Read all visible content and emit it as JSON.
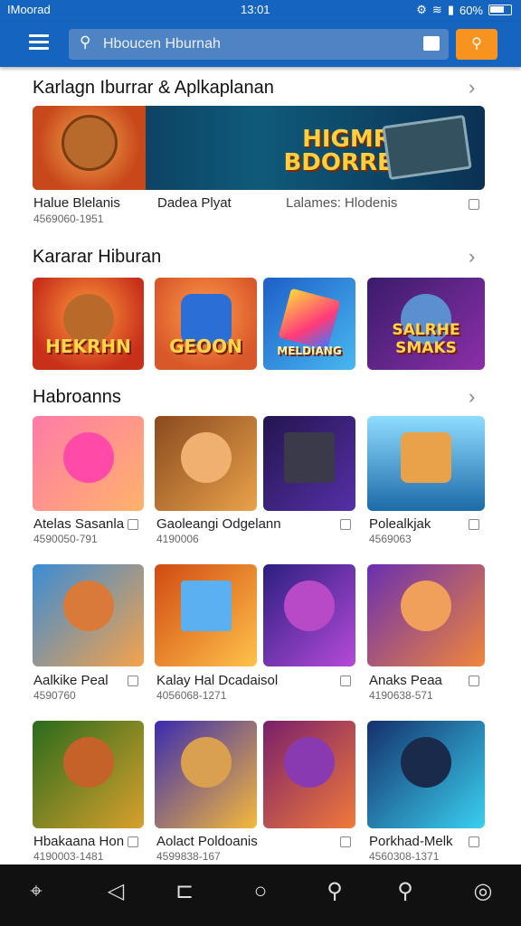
{
  "status": {
    "carrier": "IMoorad",
    "time": "13:01",
    "battery": "60%"
  },
  "topbar": {
    "search_text": "Hboucen Hburnah"
  },
  "sections": {
    "featured": {
      "title": "Karlagn Iburrar & Aplkaplanan"
    },
    "popular": {
      "title": "Kararar Hiburan"
    },
    "more": {
      "title": "Habroanns"
    }
  },
  "banner": {
    "title": "HIGMRA BDORRERS",
    "captions": [
      "Halue Blelanis",
      "Dadea Plyat",
      "Lalames: Hlodenis"
    ],
    "sub": "4569060-1951"
  },
  "popular_tiles": [
    {
      "label": "HEKRHN"
    },
    {
      "label": "GEOON"
    },
    {
      "label": "MELDIANG"
    },
    {
      "label": "SALRHE SMAKS"
    }
  ],
  "grid_rows": [
    [
      {
        "name": "Atelas Sasanla",
        "sub": "4590050-791",
        "colors": [
          "#ff7aa8",
          "#ffb36b"
        ]
      },
      {
        "name": "Gaoleangi Odgelann",
        "sub": "4190006",
        "colors": [
          "#8a4a1f",
          "#e9a24a"
        ]
      },
      {
        "name": "",
        "sub": "",
        "colors": [
          "#24154f",
          "#5530a8"
        ]
      },
      {
        "name": "Polealkjak",
        "sub": "4569063",
        "colors": [
          "#47b7f2",
          "#1c6aa8"
        ]
      }
    ],
    [
      {
        "name": "Aalkike Peal",
        "sub": "4590760",
        "colors": [
          "#3a8cd6",
          "#f5a24a"
        ]
      },
      {
        "name": "Kalay Hal Dcadaisol",
        "sub": "4056068-1271",
        "colors": [
          "#d04a12",
          "#ffc24a"
        ]
      },
      {
        "name": "",
        "sub": "",
        "colors": [
          "#2b1f80",
          "#b64ad9"
        ]
      },
      {
        "name": "Anaks Peaa",
        "sub": "4190638-571",
        "colors": [
          "#6a2fb0",
          "#f0863a"
        ]
      }
    ],
    [
      {
        "name": "Hbakaana Hon",
        "sub": "4190003-1481",
        "colors": [
          "#2a6b1c",
          "#d9a02c"
        ]
      },
      {
        "name": "Aolact Poldoanis",
        "sub": "4599838-167",
        "colors": [
          "#3a2bb0",
          "#f5b93a"
        ]
      },
      {
        "name": "",
        "sub": "",
        "colors": [
          "#7a1f6b",
          "#f07a3a"
        ]
      },
      {
        "name": "Porkhad-Melk",
        "sub": "4560308-1371",
        "colors": [
          "#14306b",
          "#3ad0f0"
        ]
      }
    ]
  ]
}
